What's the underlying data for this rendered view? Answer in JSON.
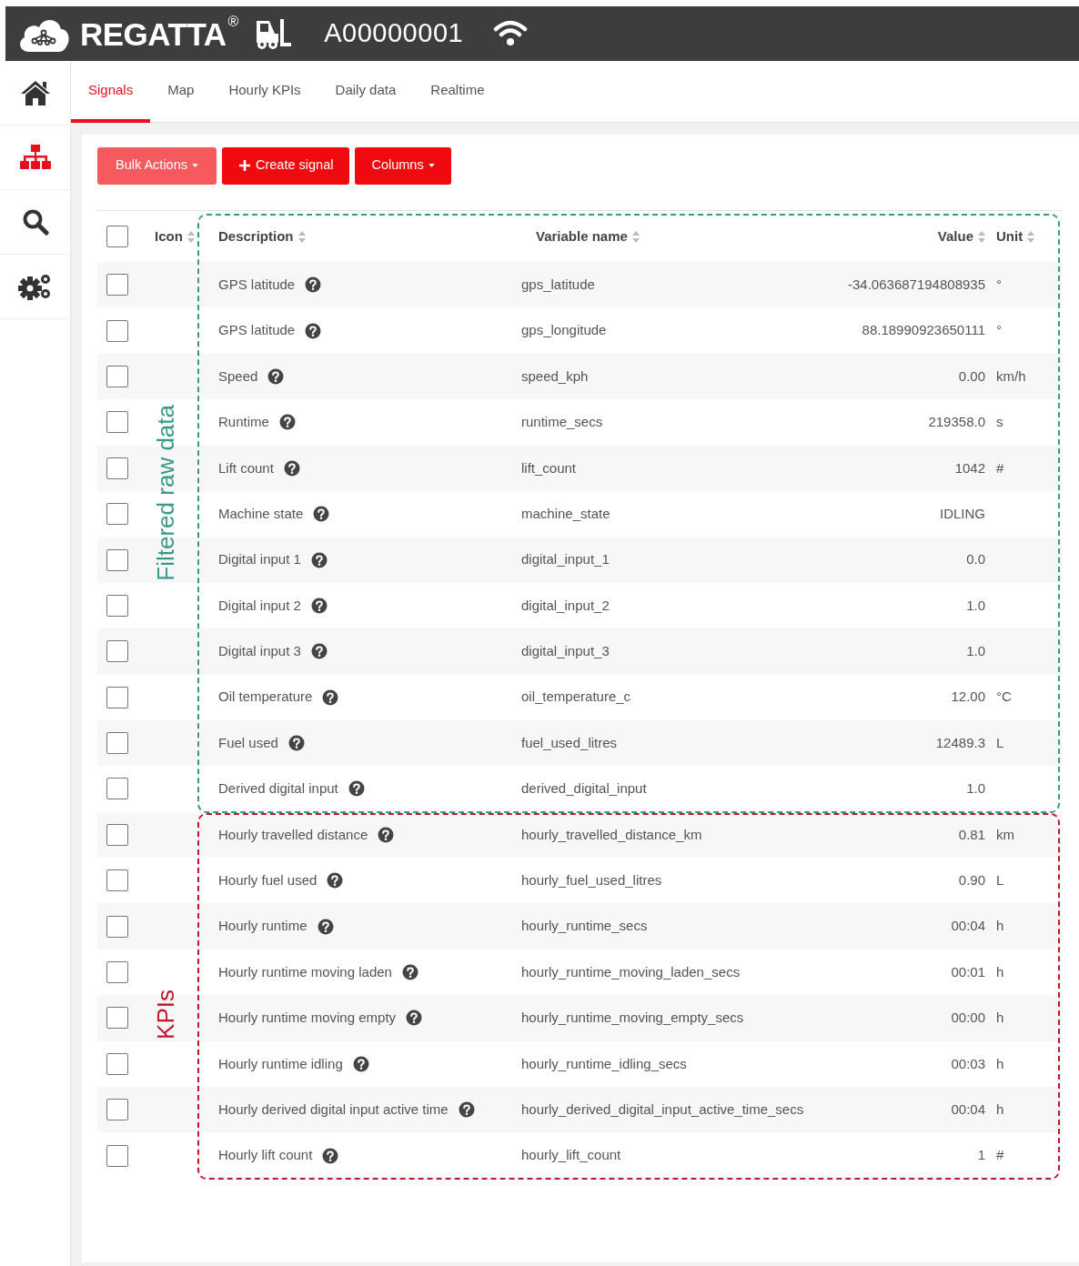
{
  "header": {
    "brand": "REGATTA",
    "brand_mark": "®",
    "device_id": "A00000001"
  },
  "sidebar": {
    "items": [
      {
        "kind": "home",
        "selected": false
      },
      {
        "kind": "hierarchy",
        "selected": true
      },
      {
        "kind": "search",
        "selected": false
      },
      {
        "kind": "settings",
        "selected": false
      }
    ]
  },
  "tabs": [
    {
      "label": "Signals",
      "selected": true
    },
    {
      "label": "Map",
      "selected": false
    },
    {
      "label": "Hourly KPIs",
      "selected": false
    },
    {
      "label": "Daily data",
      "selected": false
    },
    {
      "label": "Realtime",
      "selected": false
    }
  ],
  "toolbar": [
    {
      "label": "Bulk Actions",
      "kind": "dropdown",
      "disabled": true
    },
    {
      "label": "Create signal",
      "kind": "add",
      "disabled": false
    },
    {
      "label": "Columns",
      "kind": "dropdown",
      "disabled": false
    }
  ],
  "table": {
    "select_all_checked": false,
    "columns": [
      "Icon",
      "Description",
      "Variable name",
      "Value",
      "Unit"
    ],
    "groups": [
      {
        "label": "Filtered raw data",
        "color": "#3a9a8a",
        "rows": [
          {
            "description": "GPS latitude",
            "variable": "gps_latitude",
            "value": "-34.063687194808935",
            "unit": "°",
            "checked": false
          },
          {
            "description": "GPS latitude",
            "variable": "gps_longitude",
            "value": "88.18990923650111",
            "unit": "°",
            "checked": false
          },
          {
            "description": "Speed",
            "variable": "speed_kph",
            "value": "0.00",
            "unit": "km/h",
            "checked": false
          },
          {
            "description": "Runtime",
            "variable": "runtime_secs",
            "value": "219358.0",
            "unit": "s",
            "checked": false
          },
          {
            "description": "Lift count",
            "variable": "lift_count",
            "value": "1042",
            "unit": "#",
            "checked": false
          },
          {
            "description": "Machine state",
            "variable": "machine_state",
            "value": "IDLING",
            "checked": false
          },
          {
            "description": "Digital input 1",
            "variable": "digital_input_1",
            "value": "0.0",
            "checked": false
          },
          {
            "description": "Digital input 2",
            "variable": "digital_input_2",
            "value": "1.0",
            "checked": false
          },
          {
            "description": "Digital input 3",
            "variable": "digital_input_3",
            "value": "1.0",
            "checked": false
          },
          {
            "description": "Oil temperature",
            "variable": "oil_temperature_c",
            "value": "12.00",
            "unit": "°C",
            "checked": false
          },
          {
            "description": "Fuel used",
            "variable": "fuel_used_litres",
            "value": "12489.3",
            "unit": "L",
            "checked": false
          },
          {
            "description": "Derived digital input",
            "variable": "derived_digital_input",
            "value": "1.0",
            "checked": false
          }
        ]
      },
      {
        "label": "KPIs",
        "color": "#c0162c",
        "rows": [
          {
            "description": "Hourly travelled distance",
            "variable": "hourly_travelled_distance_km",
            "value": "0.81",
            "unit": "km",
            "checked": false
          },
          {
            "description": "Hourly fuel used",
            "variable": "hourly_fuel_used_litres",
            "value": "0.90",
            "unit": "L",
            "checked": false
          },
          {
            "description": "Hourly runtime",
            "variable": "hourly_runtime_secs",
            "value": "00:04",
            "unit": "h",
            "checked": false
          },
          {
            "description": "Hourly runtime moving laden",
            "variable": "hourly_runtime_moving_laden_secs",
            "value": "00:01",
            "unit": "h",
            "checked": false
          },
          {
            "description": "Hourly runtime moving empty",
            "variable": "hourly_runtime_moving_empty_secs",
            "value": "00:00",
            "unit": "h",
            "checked": false
          },
          {
            "description": "Hourly runtime idling",
            "variable": "hourly_runtime_idling_secs",
            "value": "00:03",
            "unit": "h",
            "checked": false
          },
          {
            "description": "Hourly derived digital input active time",
            "variable": "hourly_derived_digital_input_active_time_secs",
            "value": "00:04",
            "unit": "h",
            "checked": false
          },
          {
            "description": "Hourly lift count",
            "variable": "hourly_lift_count",
            "value": "1",
            "unit": "#",
            "checked": false
          }
        ]
      }
    ]
  }
}
